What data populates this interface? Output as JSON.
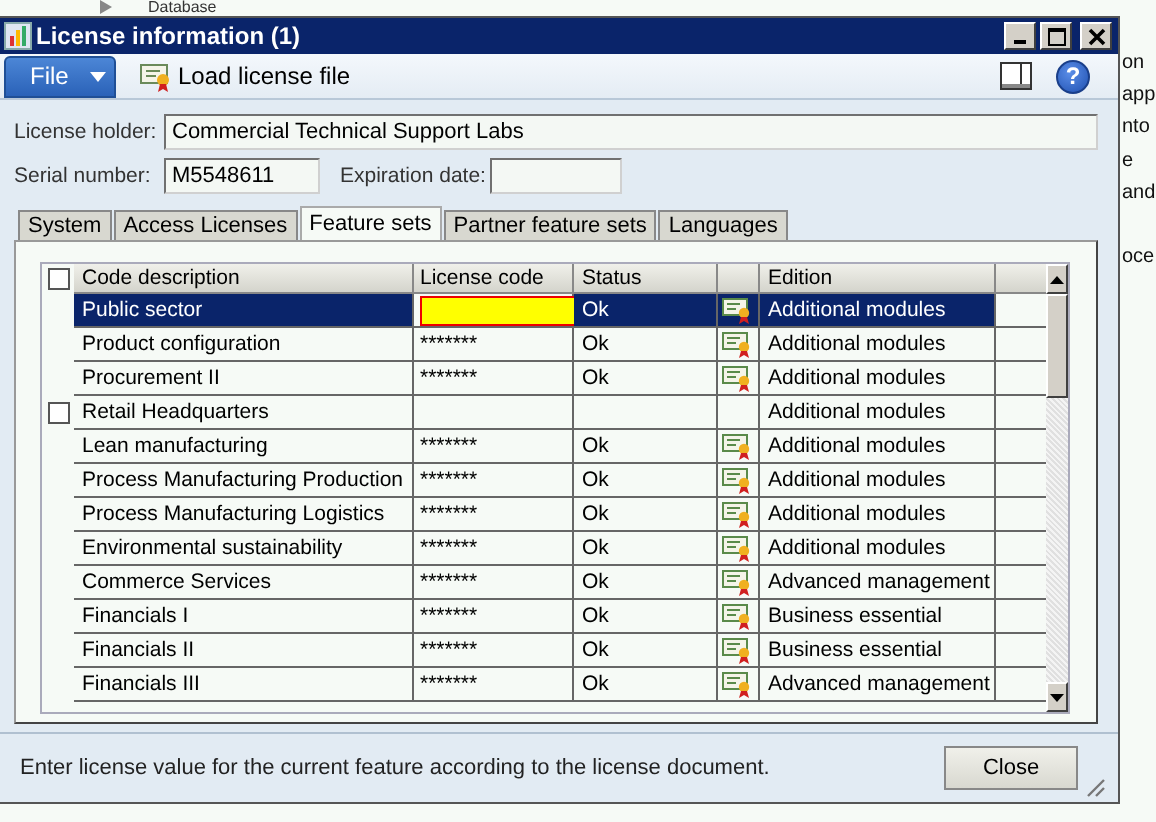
{
  "background": {
    "title": "Database",
    "fragments": [
      "on",
      "app",
      "nto",
      "e",
      "and",
      "oce"
    ]
  },
  "window": {
    "title": "License information (1)"
  },
  "toolbar": {
    "file_menu": "File",
    "load_button": "Load license file",
    "help": "?"
  },
  "form": {
    "license_holder": {
      "label": "License holder:",
      "value": "Commercial Technical Support Labs"
    },
    "serial_number": {
      "label": "Serial number:",
      "value": "M5548611"
    },
    "expiration_date": {
      "label": "Expiration date:"
    }
  },
  "tabs": [
    {
      "label": "System",
      "selected": false
    },
    {
      "label": "Access Licenses",
      "selected": false
    },
    {
      "label": "Feature sets",
      "selected": true
    },
    {
      "label": "Partner feature sets",
      "selected": false
    },
    {
      "label": "Languages",
      "selected": false
    }
  ],
  "table": {
    "select_all_checked": false,
    "columns": [
      "Code description",
      "License code",
      "Status",
      "Edition"
    ],
    "rows": [
      {
        "kind": "feature",
        "description": "Public sector",
        "license_code": "",
        "status": "Ok",
        "edition": "Additional modules",
        "selected": true,
        "editing": true
      },
      {
        "kind": "feature",
        "description": "Product configuration",
        "license_code": "*******",
        "status": "Ok",
        "edition": "Additional modules",
        "selected": false,
        "editing": false
      },
      {
        "kind": "feature",
        "description": "Procurement II",
        "license_code": "*******",
        "status": "Ok",
        "edition": "Additional modules",
        "selected": false,
        "editing": false
      },
      {
        "kind": "module",
        "description": "Retail Headquarters",
        "checked": false,
        "license_code": "",
        "status": "",
        "edition": "Additional modules",
        "selected": false,
        "editing": false
      },
      {
        "kind": "feature",
        "description": "Lean manufacturing",
        "license_code": "*******",
        "status": "Ok",
        "edition": "Additional modules",
        "selected": false,
        "editing": false
      },
      {
        "kind": "feature",
        "description": "Process Manufacturing Production",
        "license_code": "*******",
        "status": "Ok",
        "edition": "Additional modules",
        "selected": false,
        "editing": false
      },
      {
        "kind": "feature",
        "description": "Process Manufacturing Logistics",
        "license_code": "*******",
        "status": "Ok",
        "edition": "Additional modules",
        "selected": false,
        "editing": false
      },
      {
        "kind": "feature",
        "description": "Environmental sustainability",
        "license_code": "*******",
        "status": "Ok",
        "edition": "Additional modules",
        "selected": false,
        "editing": false
      },
      {
        "kind": "feature",
        "description": "Commerce Services",
        "license_code": "*******",
        "status": "Ok",
        "edition": "Advanced management",
        "selected": false,
        "editing": false
      },
      {
        "kind": "feature",
        "description": "Financials I",
        "license_code": "*******",
        "status": "Ok",
        "edition": "Business essential",
        "selected": false,
        "editing": false
      },
      {
        "kind": "feature",
        "description": "Financials II",
        "license_code": "*******",
        "status": "Ok",
        "edition": "Business essential",
        "selected": false,
        "editing": false
      },
      {
        "kind": "feature",
        "description": "Financials III",
        "license_code": "*******",
        "status": "Ok",
        "edition": "Advanced management",
        "selected": false,
        "editing": false
      }
    ]
  },
  "status_bar": {
    "message": "Enter license value for the current feature according to the license document.",
    "close_button": "Close"
  }
}
